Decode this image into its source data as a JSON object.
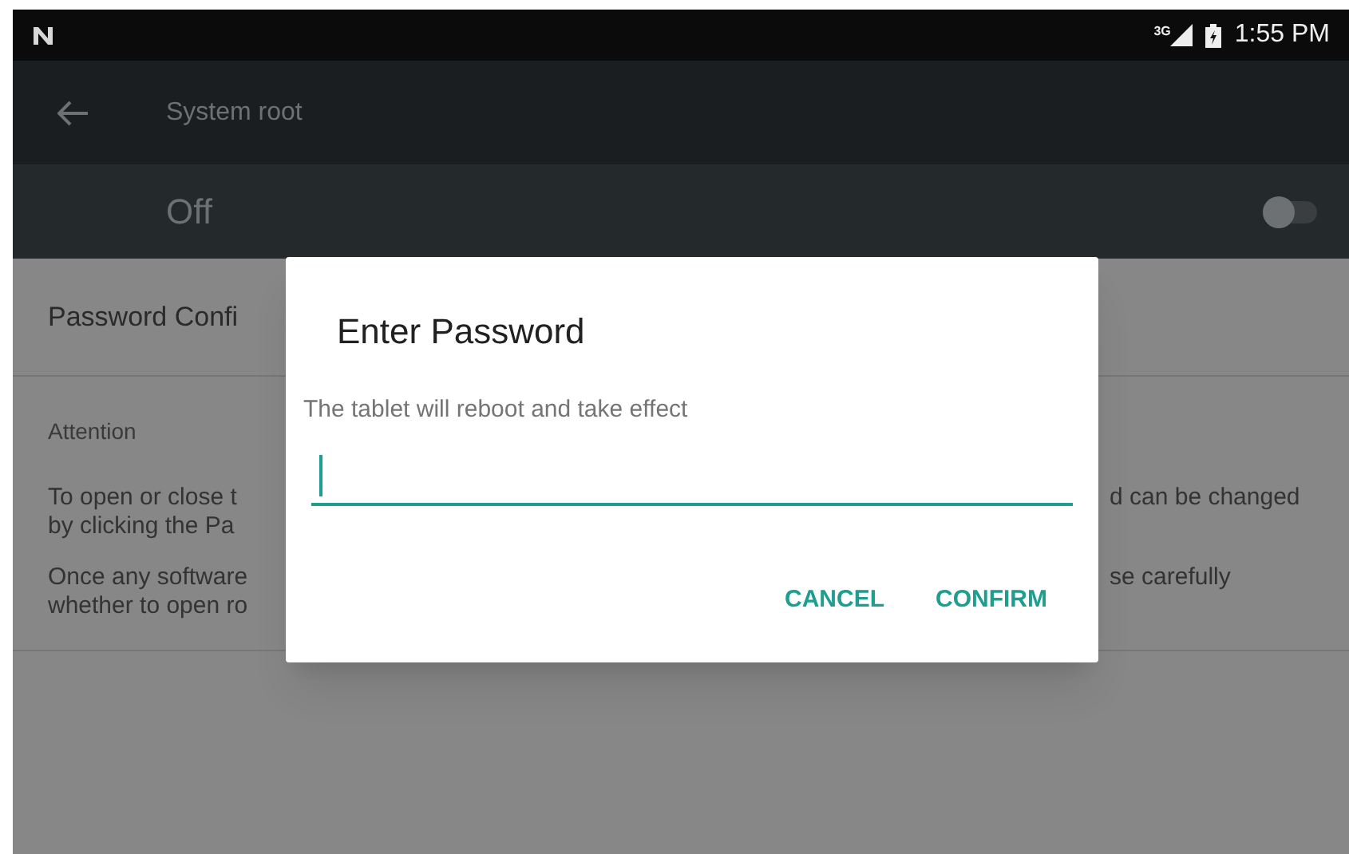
{
  "status_bar": {
    "network": "3G",
    "time": "1:55 PM"
  },
  "app_bar": {
    "title": "System root"
  },
  "switch_bar": {
    "label": "Off",
    "on": false
  },
  "settings": {
    "password_row": "Password Confi",
    "section_title": "Attention",
    "paragraphs": [
      {
        "left": [
          "To open or close t",
          "by clicking the Pa"
        ],
        "right": [
          "d can be changed"
        ]
      },
      {
        "left": [
          "Once any software",
          "whether to open ro"
        ],
        "right": [
          "se carefully"
        ]
      }
    ]
  },
  "dialog": {
    "title": "Enter Password",
    "message": "The tablet will reboot and take effect",
    "buttons": [
      "CANCEL",
      "CONFIRM"
    ]
  }
}
